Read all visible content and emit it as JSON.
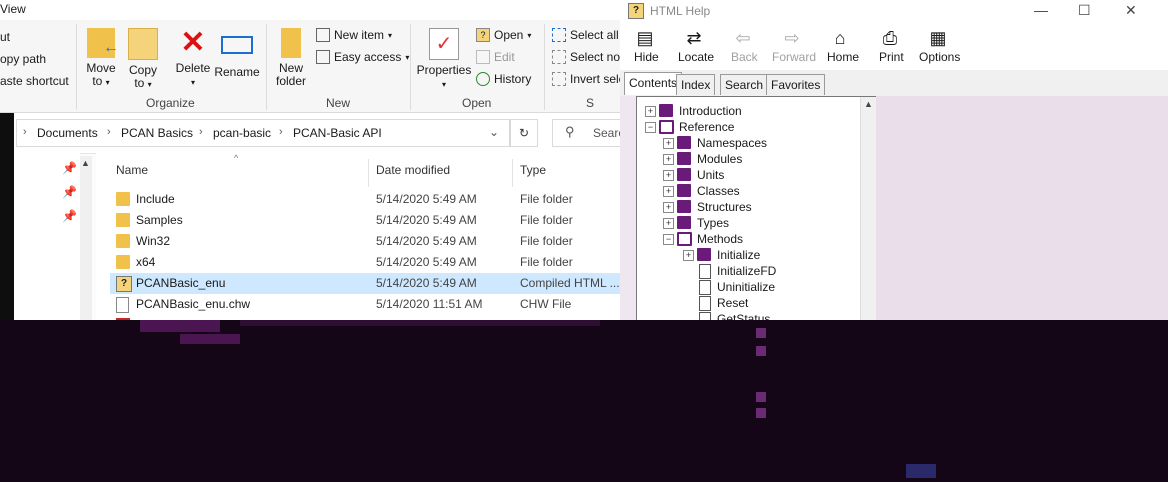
{
  "explorer": {
    "menu": {
      "view_label": "View"
    },
    "clipboard": {
      "cut": "ut",
      "copy_path": "opy path",
      "paste_shortcut": "aste shortcut"
    },
    "organize": {
      "label": "Organize",
      "move_to": [
        "Move",
        "to"
      ],
      "copy_to": [
        "Copy",
        "to"
      ],
      "delete": "Delete",
      "rename": "Rename"
    },
    "new": {
      "label": "New",
      "new_folder": [
        "New",
        "folder"
      ],
      "new_item": "New item",
      "easy_access": "Easy access"
    },
    "open": {
      "label": "Open",
      "properties": "Properties",
      "open": "Open",
      "edit": "Edit",
      "history": "History"
    },
    "select": {
      "label": "S",
      "select_all": "Select all",
      "select_none": "Select non",
      "invert": "Invert sele"
    },
    "address": {
      "crumbs": [
        "Documents",
        "PCAN Basics",
        "pcan-basic",
        "PCAN-Basic API"
      ],
      "search_placeholder": "Search P"
    },
    "columns": {
      "name": "Name",
      "date": "Date modified",
      "type": "Type"
    },
    "files": [
      {
        "name": "Include",
        "date": "5/14/2020 5:49 AM",
        "type": "File folder",
        "icon": "folder-icon"
      },
      {
        "name": "Samples",
        "date": "5/14/2020 5:49 AM",
        "type": "File folder",
        "icon": "folder-icon"
      },
      {
        "name": "Win32",
        "date": "5/14/2020 5:49 AM",
        "type": "File folder",
        "icon": "folder-icon"
      },
      {
        "name": "x64",
        "date": "5/14/2020 5:49 AM",
        "type": "File folder",
        "icon": "folder-icon"
      },
      {
        "name": "PCANBasic_enu",
        "date": "5/14/2020 5:49 AM",
        "type": "Compiled HTML ...",
        "icon": "chm-icon",
        "selected": true
      },
      {
        "name": "PCANBasic_enu.chw",
        "date": "5/14/2020 11:51 AM",
        "type": "CHW File",
        "icon": "file-icon"
      },
      {
        "name": "P",
        "date": "",
        "type": "",
        "icon": "pdf-icon"
      }
    ]
  },
  "help": {
    "title": "HTML Help",
    "toolbar": {
      "hide": "Hide",
      "locate": "Locate",
      "back": "Back",
      "forward": "Forward",
      "home": "Home",
      "print": "Print",
      "options": "Options"
    },
    "tabs": [
      "Contents",
      "Index",
      "Search",
      "Favorites"
    ],
    "tree": [
      {
        "label": "Introduction",
        "level": 0,
        "kind": "book",
        "exp": "+"
      },
      {
        "label": "Reference",
        "level": 0,
        "kind": "book-open",
        "exp": "-"
      },
      {
        "label": "Namespaces",
        "level": 1,
        "kind": "book",
        "exp": "+"
      },
      {
        "label": "Modules",
        "level": 1,
        "kind": "book",
        "exp": "+"
      },
      {
        "label": "Units",
        "level": 1,
        "kind": "book",
        "exp": "+"
      },
      {
        "label": "Classes",
        "level": 1,
        "kind": "book",
        "exp": "+"
      },
      {
        "label": "Structures",
        "level": 1,
        "kind": "book",
        "exp": "+"
      },
      {
        "label": "Types",
        "level": 1,
        "kind": "book",
        "exp": "+"
      },
      {
        "label": "Methods",
        "level": 1,
        "kind": "book-open",
        "exp": "-"
      },
      {
        "label": "Initialize",
        "level": 2,
        "kind": "book",
        "exp": "+"
      },
      {
        "label": "InitializeFD",
        "level": 2,
        "kind": "page",
        "exp": ""
      },
      {
        "label": "Uninitialize",
        "level": 2,
        "kind": "page",
        "exp": ""
      },
      {
        "label": "Reset",
        "level": 2,
        "kind": "page",
        "exp": ""
      },
      {
        "label": "GetStatus",
        "level": 2,
        "kind": "page",
        "exp": ""
      }
    ]
  }
}
